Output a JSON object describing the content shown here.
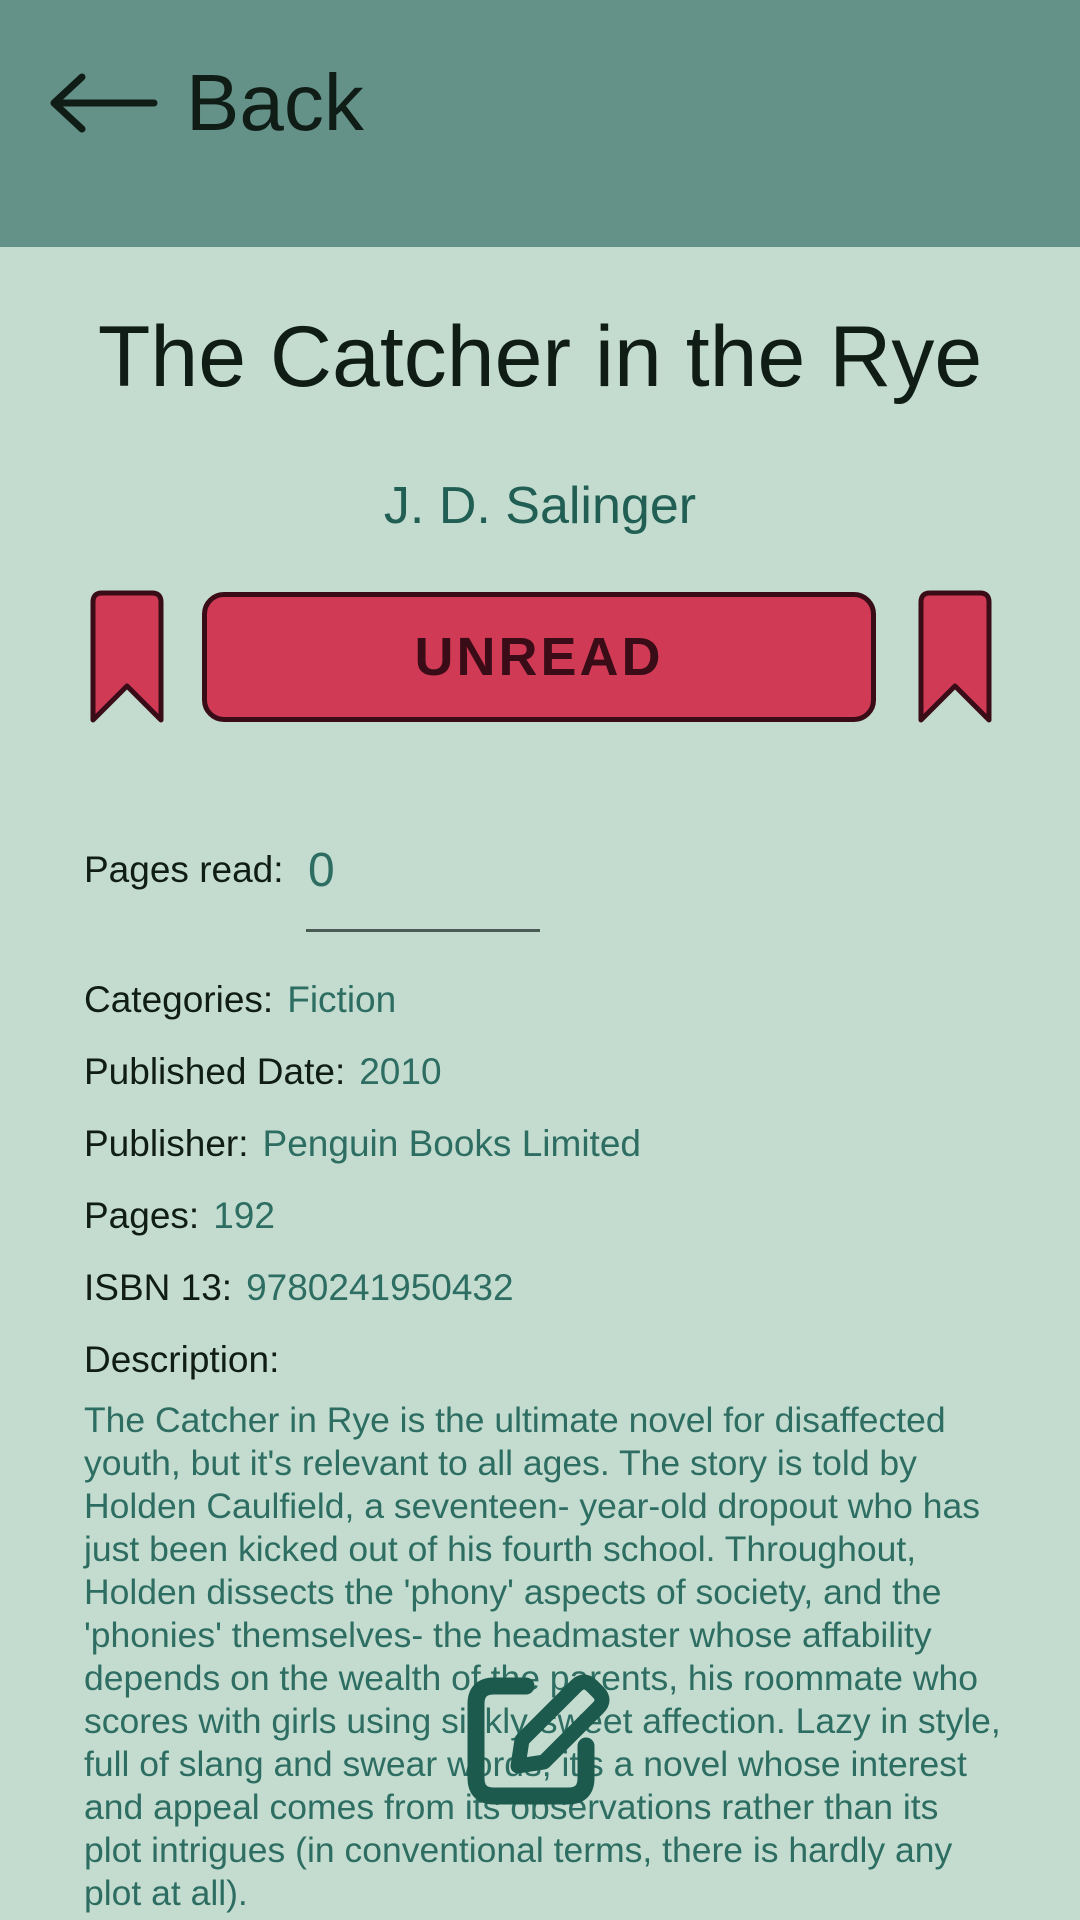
{
  "header": {
    "back_label": "Back"
  },
  "book": {
    "title": "The Catcher in the Rye",
    "author": "J. D. Salinger",
    "status_label": "UNREAD",
    "pages_read_label": "Pages read:",
    "pages_read_value": "0",
    "details": {
      "categories_label": "Categories:",
      "categories": "Fiction",
      "published_label": "Published Date:",
      "published": "2010",
      "publisher_label": "Publisher:",
      "publisher": "Penguin Books Limited",
      "pages_label": "Pages:",
      "pages": "192",
      "isbn_label": "ISBN 13:",
      "isbn": "9780241950432"
    },
    "description_label": "Description:",
    "description": "The Catcher in Rye is the ultimate novel for disaffected youth, but it's relevant to all ages. The story is told by Holden Caulfield, a seventeen- year-old dropout who has just been kicked out of his fourth school. Throughout, Holden dissects the 'phony' aspects of society, and the 'phonies' themselves- the headmaster whose affability depends on the wealth of the parents, his roommate who scores with girls using sickly-sweet affection. Lazy in style, full of slang and swear words, it's a novel whose interest and appeal comes from its observations rather than its plot intrigues (in conventional terms, there is hardly any plot at all)."
  },
  "colors": {
    "topbar": "#649289",
    "background": "#c3dccf",
    "status_fill": "#d03a55",
    "status_text": "#3a0c17",
    "value_text": "#2d6d62",
    "fab_icon": "#1d5a4e"
  },
  "icons": {
    "back": "arrow-left-icon",
    "bookmark": "bookmark-icon",
    "edit": "edit-icon"
  }
}
